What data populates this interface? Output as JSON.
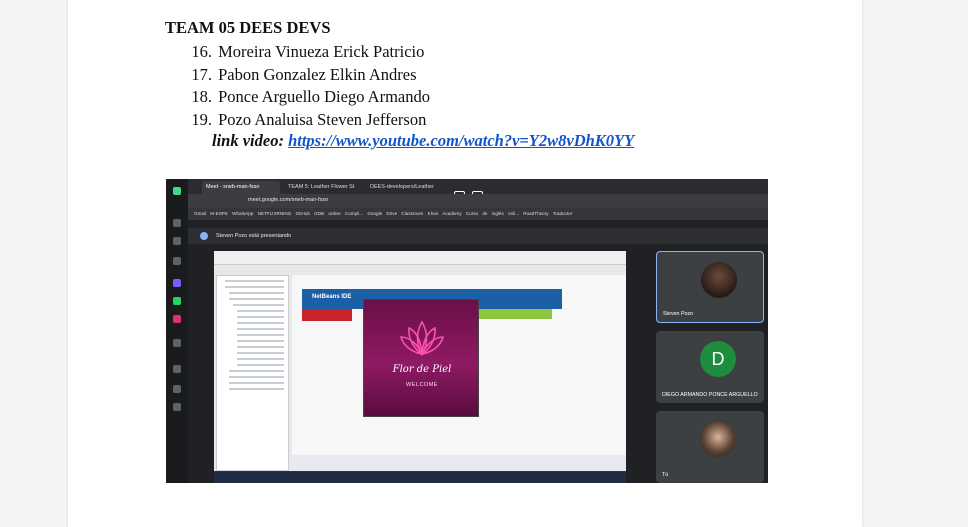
{
  "doc": {
    "heading": "TEAM 05 DEES DEVS",
    "members": [
      {
        "num": "16.",
        "name": "Moreira Vinueza Erick Patricio"
      },
      {
        "num": "17.",
        "name": "Pabon Gonzalez Elkin Andres"
      },
      {
        "num": "18.",
        "name": "Ponce Arguello Diego Armando"
      },
      {
        "num": "19.",
        "name": "Pozo Analuisa Steven Jefferson"
      }
    ],
    "link_label": "link video:",
    "link_url": "https://www.youtube.com/watch?v=Y2w8vDhK0YY"
  },
  "screenshot": {
    "tabs": [
      "Meet - sneb-man-fsso",
      "TEAM 5: Leather Flower St",
      "DEES-developers/Leather"
    ],
    "url": "meet.google.com/sneb-man-fsso",
    "bookmarks": "Gmail   M-ESPE   WhatsApp   NETFLIXRNING   GitHub   GDB online Compil...   Google Drive   Classroom   Khan Academy   Curso de inglés onli...   RoadTheory   Traductor",
    "presenting": "Steven Pozo está presentando",
    "ide_banner": "NetBeans IDE",
    "splash_title": "Flor de Piel",
    "splash_welcome": "WELCOME",
    "participants": [
      {
        "name": "Steven Pozo"
      },
      {
        "name": "DIEGO ARMANDO PONCE ARGUELLO",
        "initial": "D"
      },
      {
        "name": "Tú"
      }
    ]
  }
}
